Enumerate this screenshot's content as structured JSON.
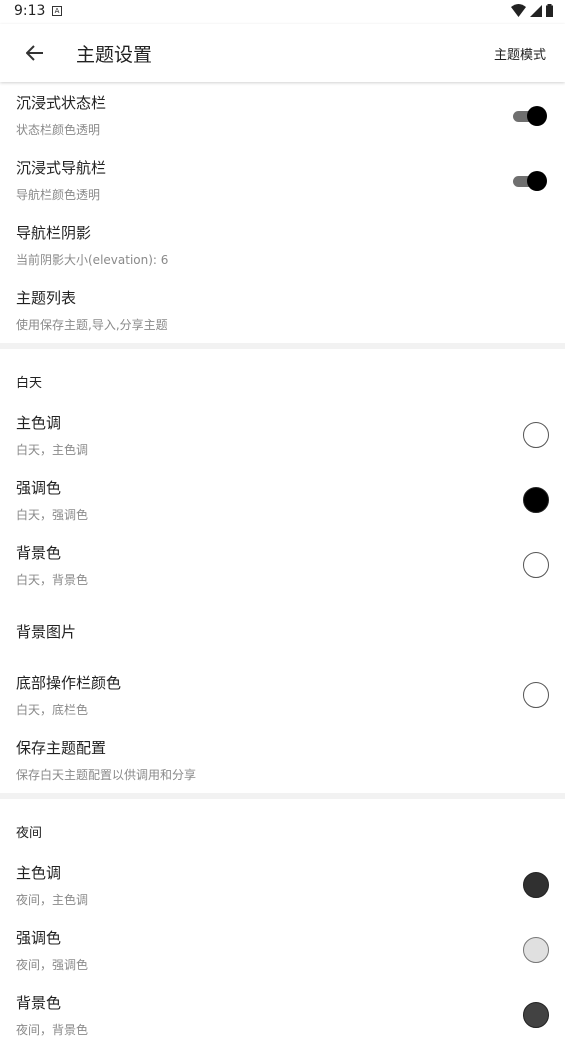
{
  "status_bar": {
    "time": "9:13"
  },
  "app_bar": {
    "title": "主题设置",
    "action": "主题模式"
  },
  "general": [
    {
      "title": "沉浸式状态栏",
      "subtitle": "状态栏颜色透明",
      "switch_on": true
    },
    {
      "title": "沉浸式导航栏",
      "subtitle": "导航栏颜色透明",
      "switch_on": true
    },
    {
      "title": "导航栏阴影",
      "subtitle": "当前阴影大小(elevation): 6"
    },
    {
      "title": "主题列表",
      "subtitle": "使用保存主题,导入,分享主题"
    }
  ],
  "day": {
    "header": "白天",
    "items": [
      {
        "title": "主色调",
        "subtitle": "白天，主色调",
        "color": "#ffffff"
      },
      {
        "title": "强调色",
        "subtitle": "白天，强调色",
        "color": "#000000"
      },
      {
        "title": "背景色",
        "subtitle": "白天，背景色",
        "color": "#ffffff"
      },
      {
        "title": "背景图片"
      },
      {
        "title": "底部操作栏颜色",
        "subtitle": "白天，底栏色",
        "color": "#ffffff"
      },
      {
        "title": "保存主题配置",
        "subtitle": "保存白天主题配置以供调用和分享"
      }
    ]
  },
  "night": {
    "header": "夜间",
    "items": [
      {
        "title": "主色调",
        "subtitle": "夜间，主色调",
        "color": "#303030"
      },
      {
        "title": "强调色",
        "subtitle": "夜间，强调色",
        "color": "#e0e0e0"
      },
      {
        "title": "背景色",
        "subtitle": "夜间，背景色",
        "color": "#424242"
      }
    ]
  }
}
